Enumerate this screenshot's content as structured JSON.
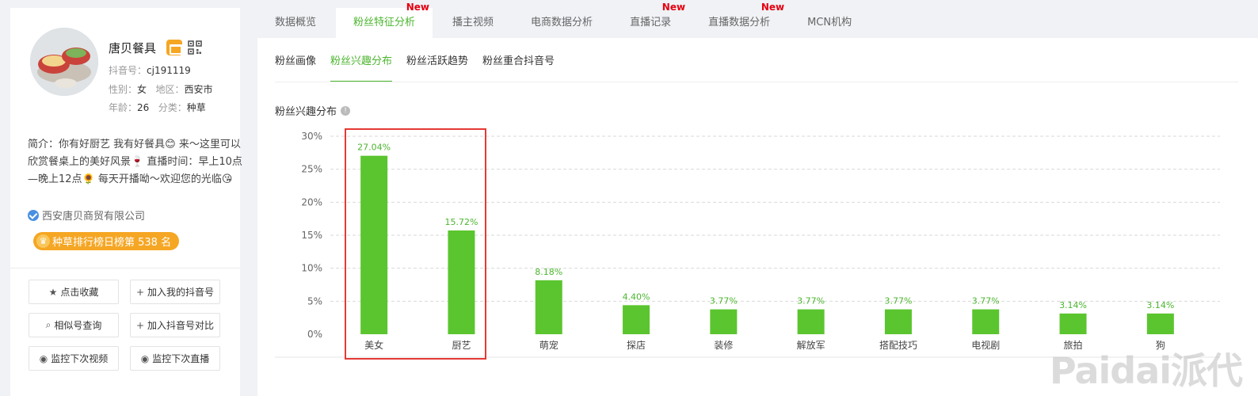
{
  "profile": {
    "name": "唐贝餐具",
    "douyin_label": "抖音号：",
    "douyin_id": "cj191119",
    "gender_label": "性别：",
    "gender": "女",
    "region_label": "地区：",
    "region": "西安市",
    "age_label": "年龄：",
    "age": "26",
    "category_label": "分类：",
    "category": "种草",
    "intro": "简介：你有好厨艺 我有好餐具😊 来～这里可以欣赏餐桌上的美好风景🍷 直播时间：早上10点—晚上12点🌻 每天开播呦～欢迎您的光临😘",
    "company": "西安唐贝商贸有限公司",
    "rank_badge": "种草排行榜日榜第 538 名",
    "crown_glyph": "♛"
  },
  "actions": [
    {
      "name": "collect-button",
      "icon": "★",
      "label": "点击收藏"
    },
    {
      "name": "add-my-douyin-button",
      "icon": "+",
      "label": "加入我的抖音号"
    },
    {
      "name": "similar-search-button",
      "icon": "⌕",
      "label": "相似号查询"
    },
    {
      "name": "add-compare-button",
      "icon": "+",
      "label": "加入抖音号对比"
    },
    {
      "name": "monitor-video-button",
      "icon": "◉",
      "label": "监控下次视频"
    },
    {
      "name": "monitor-live-button",
      "icon": "◉",
      "label": "监控下次直播"
    }
  ],
  "tabs": [
    {
      "label": "数据概览",
      "new": false,
      "active": false
    },
    {
      "label": "粉丝特征分析",
      "new": true,
      "active": true
    },
    {
      "label": "播主视频",
      "new": false,
      "active": false
    },
    {
      "label": "电商数据分析",
      "new": false,
      "active": false
    },
    {
      "label": "直播记录",
      "new": true,
      "active": false
    },
    {
      "label": "直播数据分析",
      "new": true,
      "active": false
    },
    {
      "label": "MCN机构",
      "new": false,
      "active": false
    }
  ],
  "new_tag": "New",
  "subtabs": [
    {
      "label": "粉丝画像",
      "active": false
    },
    {
      "label": "粉丝兴趣分布",
      "active": true
    },
    {
      "label": "粉丝活跃趋势",
      "active": false
    },
    {
      "label": "粉丝重合抖音号",
      "active": false
    }
  ],
  "chart_title": "粉丝兴趣分布",
  "info_glyph": "!",
  "colors": {
    "accent": "#4bb52e",
    "bar": "#5bc52f",
    "highlight": "#e53935",
    "new_tag": "#e60012",
    "rank_badge": "#f5a623"
  },
  "watermark": "Paidai派代",
  "chart_data": {
    "type": "bar",
    "title": "粉丝兴趣分布",
    "categories": [
      "美女",
      "厨艺",
      "萌宠",
      "探店",
      "装修",
      "解放军",
      "搭配技巧",
      "电视剧",
      "旅拍",
      "狗"
    ],
    "values": [
      27.04,
      15.72,
      8.18,
      4.4,
      3.77,
      3.77,
      3.77,
      3.77,
      3.14,
      3.14
    ],
    "value_labels": [
      "27.04%",
      "15.72%",
      "8.18%",
      "4.40%",
      "3.77%",
      "3.77%",
      "3.77%",
      "3.77%",
      "3.14%",
      "3.14%"
    ],
    "yticks": [
      "0%",
      "5%",
      "10%",
      "15%",
      "20%",
      "25%",
      "30%"
    ],
    "ylim": [
      0,
      30
    ],
    "grid": true,
    "highlighted_categories": [
      "美女",
      "厨艺"
    ]
  }
}
